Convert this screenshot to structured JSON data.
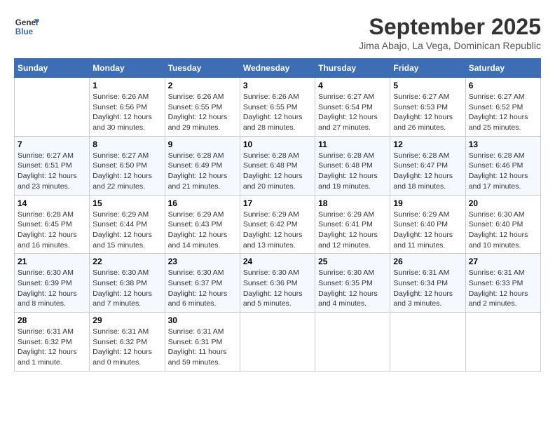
{
  "header": {
    "logo_line1": "General",
    "logo_line2": "Blue",
    "month": "September 2025",
    "location": "Jima Abajo, La Vega, Dominican Republic"
  },
  "days_of_week": [
    "Sunday",
    "Monday",
    "Tuesday",
    "Wednesday",
    "Thursday",
    "Friday",
    "Saturday"
  ],
  "weeks": [
    [
      {
        "day": "",
        "info": ""
      },
      {
        "day": "1",
        "info": "Sunrise: 6:26 AM\nSunset: 6:56 PM\nDaylight: 12 hours\nand 30 minutes."
      },
      {
        "day": "2",
        "info": "Sunrise: 6:26 AM\nSunset: 6:55 PM\nDaylight: 12 hours\nand 29 minutes."
      },
      {
        "day": "3",
        "info": "Sunrise: 6:26 AM\nSunset: 6:55 PM\nDaylight: 12 hours\nand 28 minutes."
      },
      {
        "day": "4",
        "info": "Sunrise: 6:27 AM\nSunset: 6:54 PM\nDaylight: 12 hours\nand 27 minutes."
      },
      {
        "day": "5",
        "info": "Sunrise: 6:27 AM\nSunset: 6:53 PM\nDaylight: 12 hours\nand 26 minutes."
      },
      {
        "day": "6",
        "info": "Sunrise: 6:27 AM\nSunset: 6:52 PM\nDaylight: 12 hours\nand 25 minutes."
      }
    ],
    [
      {
        "day": "7",
        "info": "Sunrise: 6:27 AM\nSunset: 6:51 PM\nDaylight: 12 hours\nand 23 minutes."
      },
      {
        "day": "8",
        "info": "Sunrise: 6:27 AM\nSunset: 6:50 PM\nDaylight: 12 hours\nand 22 minutes."
      },
      {
        "day": "9",
        "info": "Sunrise: 6:28 AM\nSunset: 6:49 PM\nDaylight: 12 hours\nand 21 minutes."
      },
      {
        "day": "10",
        "info": "Sunrise: 6:28 AM\nSunset: 6:48 PM\nDaylight: 12 hours\nand 20 minutes."
      },
      {
        "day": "11",
        "info": "Sunrise: 6:28 AM\nSunset: 6:48 PM\nDaylight: 12 hours\nand 19 minutes."
      },
      {
        "day": "12",
        "info": "Sunrise: 6:28 AM\nSunset: 6:47 PM\nDaylight: 12 hours\nand 18 minutes."
      },
      {
        "day": "13",
        "info": "Sunrise: 6:28 AM\nSunset: 6:46 PM\nDaylight: 12 hours\nand 17 minutes."
      }
    ],
    [
      {
        "day": "14",
        "info": "Sunrise: 6:28 AM\nSunset: 6:45 PM\nDaylight: 12 hours\nand 16 minutes."
      },
      {
        "day": "15",
        "info": "Sunrise: 6:29 AM\nSunset: 6:44 PM\nDaylight: 12 hours\nand 15 minutes."
      },
      {
        "day": "16",
        "info": "Sunrise: 6:29 AM\nSunset: 6:43 PM\nDaylight: 12 hours\nand 14 minutes."
      },
      {
        "day": "17",
        "info": "Sunrise: 6:29 AM\nSunset: 6:42 PM\nDaylight: 12 hours\nand 13 minutes."
      },
      {
        "day": "18",
        "info": "Sunrise: 6:29 AM\nSunset: 6:41 PM\nDaylight: 12 hours\nand 12 minutes."
      },
      {
        "day": "19",
        "info": "Sunrise: 6:29 AM\nSunset: 6:40 PM\nDaylight: 12 hours\nand 11 minutes."
      },
      {
        "day": "20",
        "info": "Sunrise: 6:30 AM\nSunset: 6:40 PM\nDaylight: 12 hours\nand 10 minutes."
      }
    ],
    [
      {
        "day": "21",
        "info": "Sunrise: 6:30 AM\nSunset: 6:39 PM\nDaylight: 12 hours\nand 8 minutes."
      },
      {
        "day": "22",
        "info": "Sunrise: 6:30 AM\nSunset: 6:38 PM\nDaylight: 12 hours\nand 7 minutes."
      },
      {
        "day": "23",
        "info": "Sunrise: 6:30 AM\nSunset: 6:37 PM\nDaylight: 12 hours\nand 6 minutes."
      },
      {
        "day": "24",
        "info": "Sunrise: 6:30 AM\nSunset: 6:36 PM\nDaylight: 12 hours\nand 5 minutes."
      },
      {
        "day": "25",
        "info": "Sunrise: 6:30 AM\nSunset: 6:35 PM\nDaylight: 12 hours\nand 4 minutes."
      },
      {
        "day": "26",
        "info": "Sunrise: 6:31 AM\nSunset: 6:34 PM\nDaylight: 12 hours\nand 3 minutes."
      },
      {
        "day": "27",
        "info": "Sunrise: 6:31 AM\nSunset: 6:33 PM\nDaylight: 12 hours\nand 2 minutes."
      }
    ],
    [
      {
        "day": "28",
        "info": "Sunrise: 6:31 AM\nSunset: 6:32 PM\nDaylight: 12 hours\nand 1 minute."
      },
      {
        "day": "29",
        "info": "Sunrise: 6:31 AM\nSunset: 6:32 PM\nDaylight: 12 hours\nand 0 minutes."
      },
      {
        "day": "30",
        "info": "Sunrise: 6:31 AM\nSunset: 6:31 PM\nDaylight: 11 hours\nand 59 minutes."
      },
      {
        "day": "",
        "info": ""
      },
      {
        "day": "",
        "info": ""
      },
      {
        "day": "",
        "info": ""
      },
      {
        "day": "",
        "info": ""
      }
    ]
  ]
}
